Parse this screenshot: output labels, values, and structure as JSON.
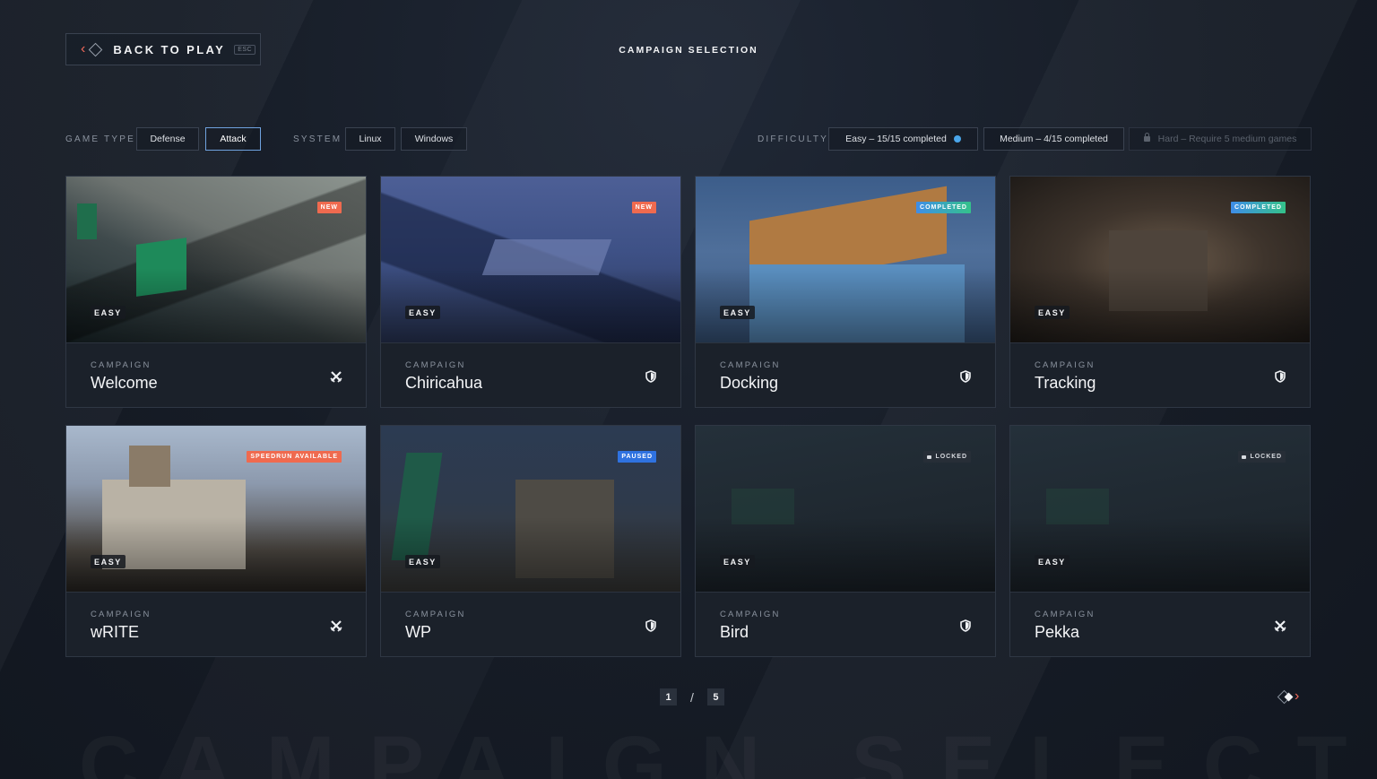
{
  "header": {
    "back_label": "BACK TO PLAY",
    "esc_hint": "ESC",
    "title": "CAMPAIGN SELECTION",
    "watermark": "CAMPAIGN SELECTION"
  },
  "filters": {
    "game_type": {
      "label": "GAME TYPE",
      "options": [
        "Defense",
        "Attack"
      ],
      "selected": "Attack"
    },
    "system": {
      "label": "SYSTEM",
      "options": [
        "Linux",
        "Windows"
      ]
    },
    "difficulty": {
      "label": "DIFFICULTY",
      "options": [
        {
          "label": "Easy – 15/15 completed",
          "status": "complete"
        },
        {
          "label": "Medium – 4/15 completed",
          "status": "in-progress"
        },
        {
          "label": "Hard – Require 5 medium games",
          "status": "locked"
        }
      ]
    }
  },
  "campaigns": [
    {
      "kicker": "CAMPAIGN",
      "name": "Welcome",
      "difficulty": "EASY",
      "badge": "NEW",
      "icon": "crossed-swords-icon"
    },
    {
      "kicker": "CAMPAIGN",
      "name": "Chiricahua",
      "difficulty": "EASY",
      "badge": "NEW",
      "icon": "shield-icon"
    },
    {
      "kicker": "CAMPAIGN",
      "name": "Docking",
      "difficulty": "EASY",
      "badge": "COMPLETED",
      "icon": "shield-icon"
    },
    {
      "kicker": "CAMPAIGN",
      "name": "Tracking",
      "difficulty": "EASY",
      "badge": "COMPLETED",
      "icon": "shield-icon"
    },
    {
      "kicker": "CAMPAIGN",
      "name": "wRITE",
      "difficulty": "EASY",
      "badge": "SPEEDRUN AVAILABLE",
      "icon": "crossed-swords-icon"
    },
    {
      "kicker": "CAMPAIGN",
      "name": "WP",
      "difficulty": "EASY",
      "badge": "PAUSED",
      "icon": "shield-icon"
    },
    {
      "kicker": "CAMPAIGN",
      "name": "Bird",
      "difficulty": "EASY",
      "badge": "LOCKED",
      "icon": "shield-icon"
    },
    {
      "kicker": "CAMPAIGN",
      "name": "Pekka",
      "difficulty": "EASY",
      "badge": "LOCKED",
      "icon": "crossed-swords-icon"
    }
  ],
  "pagination": {
    "current": "1",
    "separator": "/",
    "total": "5"
  },
  "colors": {
    "accent": "#f0685a",
    "selected_border": "#6fa2de",
    "badge_new": "#ef6a4f",
    "badge_paused": "#2f72e0",
    "badge_completed": "#34c28a"
  }
}
